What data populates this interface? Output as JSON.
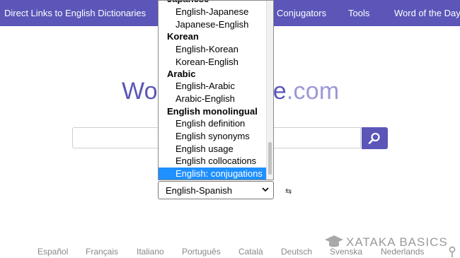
{
  "nav": {
    "direct_links": "Direct Links to English Dictionaries",
    "conjugators": "Conjugators",
    "tools": "Tools",
    "word_of_day": "Word of the Day"
  },
  "logo": {
    "left": "Wo",
    "right_a": "e",
    "right_b": ".com"
  },
  "search": {
    "value": ""
  },
  "selected_dictionary": "English-Spanish",
  "swap_symbol": "⇆",
  "dropdown": {
    "partial_top": "Japanese",
    "rows": [
      {
        "kind": "opt",
        "text": "English-Japanese"
      },
      {
        "kind": "opt",
        "text": "Japanese-English"
      },
      {
        "kind": "group",
        "text": "Korean"
      },
      {
        "kind": "opt",
        "text": "English-Korean"
      },
      {
        "kind": "opt",
        "text": "Korean-English"
      },
      {
        "kind": "group",
        "text": "Arabic"
      },
      {
        "kind": "opt",
        "text": "English-Arabic"
      },
      {
        "kind": "opt",
        "text": "Arabic-English"
      },
      {
        "kind": "group",
        "text": "English monolingual"
      },
      {
        "kind": "opt",
        "text": "English definition"
      },
      {
        "kind": "opt",
        "text": "English synonyms"
      },
      {
        "kind": "opt",
        "text": "English usage"
      },
      {
        "kind": "opt",
        "text": "English collocations"
      },
      {
        "kind": "sel",
        "text": "English: conjugations"
      }
    ]
  },
  "languages": [
    "Español",
    "Français",
    "Italiano",
    "Português",
    "Català",
    "Deutsch",
    "Svenska",
    "Nederlands"
  ],
  "watermark": "XATAKA BASICS",
  "colors": {
    "brand": "#5b56b8",
    "brand_light": "#9c98d8",
    "selection": "#1e90ff"
  }
}
